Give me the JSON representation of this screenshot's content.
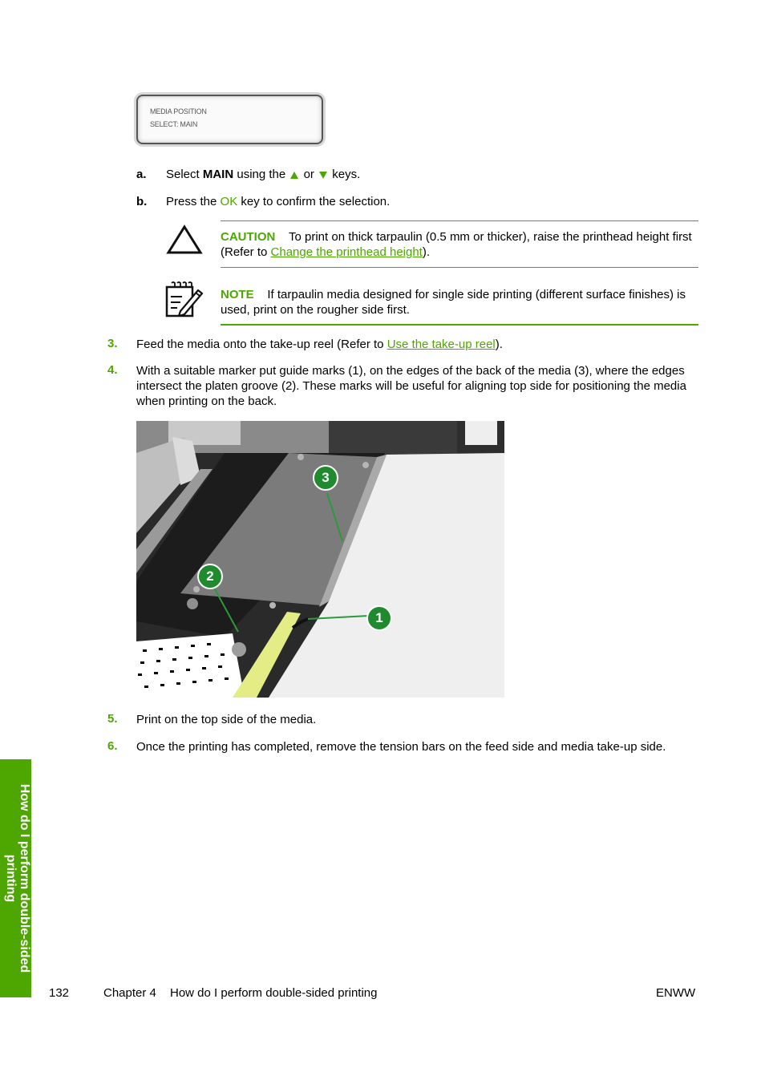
{
  "lcd_panel": {
    "line1": "MEDIA POSITION",
    "line2": "SELECT: MAIN"
  },
  "substeps": [
    {
      "letter": "a.",
      "text_before": "Select ",
      "bold": "MAIN",
      "text_mid": " using the ",
      "up_icon": "up-arrow-icon",
      "or": " or ",
      "down_icon": "down-arrow-icon",
      "text_after": " keys."
    },
    {
      "letter": "b.",
      "text_before": "Press the ",
      "key": "OK",
      "text_after": " key to confirm the selection."
    }
  ],
  "caution": {
    "icon": "caution-triangle-icon",
    "label": "CAUTION",
    "text_before": "To print on thick tarpaulin (0.5 mm or thicker), raise the printhead height first (Refer to ",
    "link": "Change the printhead height",
    "text_after": ")."
  },
  "note": {
    "icon": "note-pad-pencil-icon",
    "label": "NOTE",
    "text": "If tarpaulin media designed for single side printing (different surface finishes) is used, print on the rougher side first."
  },
  "steps": [
    {
      "number": "3.",
      "text_before": "Feed the media onto the take-up reel (Refer to ",
      "link": "Use the take-up reel",
      "text_after": ")."
    },
    {
      "number": "4.",
      "text": "With a suitable marker put guide marks (1), on the edges of the back of the media (3), where the edges intersect the platen groove (2). These marks will be useful for aligning top side for positioning the media when printing on the back."
    },
    {
      "number": "5.",
      "text": "Print on the top side of the media."
    },
    {
      "number": "6.",
      "text": "Once the printing has completed, remove the tension bars on the feed side and media take-up side."
    }
  ],
  "photo": {
    "callouts": [
      "1",
      "2",
      "3"
    ]
  },
  "side_tab": {
    "text": "How do I perform double-sided printing"
  },
  "footer": {
    "page_number": "132",
    "chapter": "Chapter 4",
    "chapter_title": "How do I perform double-sided printing",
    "right": "ENWW"
  },
  "colors": {
    "accent": "#4ea600"
  }
}
